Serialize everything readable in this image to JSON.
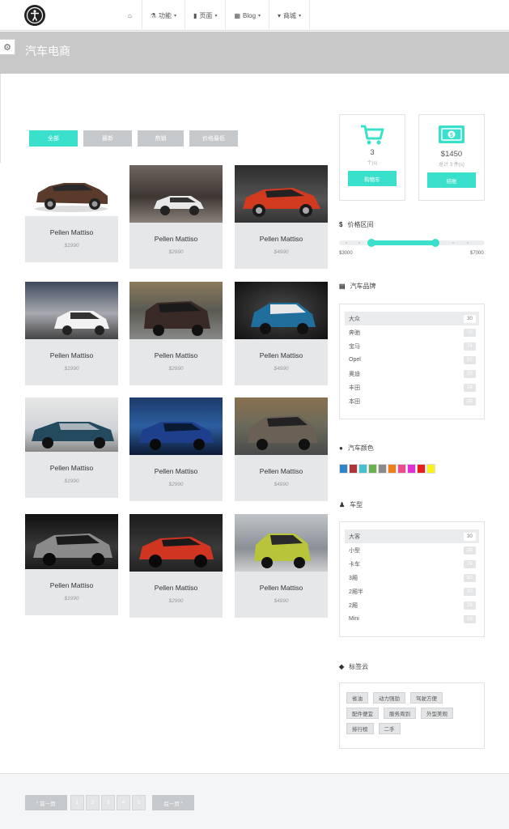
{
  "nav": {
    "items": [
      {
        "icon": "home-icon",
        "label": ""
      },
      {
        "icon": "flask-icon",
        "label": "功能"
      },
      {
        "icon": "file-icon",
        "label": "页面"
      },
      {
        "icon": "calendar-icon",
        "label": "Blog"
      },
      {
        "icon": "cart-icon",
        "label": "商城"
      }
    ]
  },
  "header": {
    "title": "汽车电商"
  },
  "filters": [
    "全部",
    "最新",
    "热销",
    "价格最低"
  ],
  "products": [
    {
      "name": "Pellen Mattiso",
      "price": "$1990"
    },
    {
      "name": "Pellen Mattiso",
      "price": "$2990"
    },
    {
      "name": "Pellen Mattiso",
      "price": "$4990"
    },
    {
      "name": "Pellen Mattiso",
      "price": "$1990"
    },
    {
      "name": "Pellen Mattiso",
      "price": "$2990"
    },
    {
      "name": "Pellen Mattiso",
      "price": "$4990"
    },
    {
      "name": "Pellen Mattiso",
      "price": "$1990"
    },
    {
      "name": "Pellen Mattiso",
      "price": "$2990"
    },
    {
      "name": "Pellen Mattiso",
      "price": "$4990"
    },
    {
      "name": "Pellen Mattiso",
      "price": "$1990"
    },
    {
      "name": "Pellen Mattiso",
      "price": "$2990"
    },
    {
      "name": "Pellen Mattiso",
      "price": "$4990"
    }
  ],
  "cart": {
    "count": "3",
    "sub": "个(s)",
    "button": "购物车"
  },
  "total": {
    "amount": "$1450",
    "sub": "总计 3 件(s)",
    "button": "结账"
  },
  "price_range": {
    "title": "价格区间",
    "min_label": "$3000",
    "max_label": "$7000",
    "low_fraction": 0.22,
    "high_fraction": 0.66
  },
  "brands": {
    "title": "汽车品牌",
    "items": [
      {
        "label": "大众",
        "count": "30"
      },
      {
        "label": "奔驰",
        "count": "70"
      },
      {
        "label": "宝马",
        "count": "74"
      },
      {
        "label": "Opel",
        "count": "82"
      },
      {
        "label": "奥迪",
        "count": "20"
      },
      {
        "label": "丰田",
        "count": "28"
      },
      {
        "label": "本田",
        "count": "28"
      }
    ]
  },
  "colors": {
    "title": "汽车颜色",
    "swatches": [
      "#2f86c6",
      "#b0323a",
      "#45c0d1",
      "#6ab04c",
      "#8a8a8a",
      "#f07f1a",
      "#ea4c8f",
      "#e12fd6",
      "#e81d1d",
      "#f7f21b"
    ]
  },
  "body_types": {
    "title": "车型",
    "items": [
      {
        "label": "大客",
        "count": "30"
      },
      {
        "label": "小型",
        "count": "28"
      },
      {
        "label": "卡车",
        "count": "74"
      },
      {
        "label": "3厢",
        "count": "82"
      },
      {
        "label": "2厢半",
        "count": "20"
      },
      {
        "label": "2厢",
        "count": "28"
      },
      {
        "label": "Mini",
        "count": "28"
      }
    ]
  },
  "tags": {
    "title": "标签云",
    "rows": [
      [
        "省油",
        "动力强劲",
        "驾驶方便"
      ],
      [
        "配件便宜",
        "服务周到",
        "外型美观"
      ],
      [
        "排行榜",
        "二手"
      ]
    ]
  },
  "pagination": {
    "prev": "前一页",
    "next": "后一页",
    "pages": [
      "1",
      "2",
      "3",
      "4",
      "5"
    ]
  }
}
